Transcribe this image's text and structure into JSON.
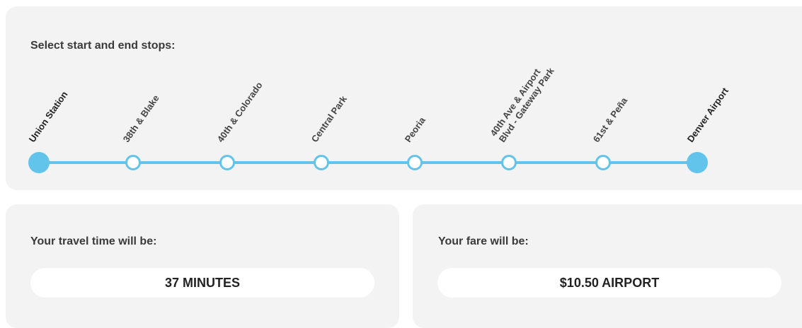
{
  "stops_panel": {
    "label": "Select start and end stops:",
    "stops": [
      {
        "name": "Union Station",
        "name_line2": "",
        "selected": true
      },
      {
        "name": "38th & Blake",
        "name_line2": "",
        "selected": false
      },
      {
        "name": "40th & Colorado",
        "name_line2": "",
        "selected": false
      },
      {
        "name": "Central Park",
        "name_line2": "",
        "selected": false
      },
      {
        "name": "Peoria",
        "name_line2": "",
        "selected": false
      },
      {
        "name": "40th Ave & Airport",
        "name_line2": "Blvd - Gateway Park",
        "selected": false
      },
      {
        "name": "61st & Peña",
        "name_line2": "",
        "selected": false
      },
      {
        "name": "Denver Airport",
        "name_line2": "",
        "selected": true
      }
    ],
    "route_color": "#62c3eb"
  },
  "travel_time": {
    "label": "Your travel time will be:",
    "value": "37 MINUTES"
  },
  "fare": {
    "label": "Your fare will be:",
    "value": "$10.50 AIRPORT"
  }
}
